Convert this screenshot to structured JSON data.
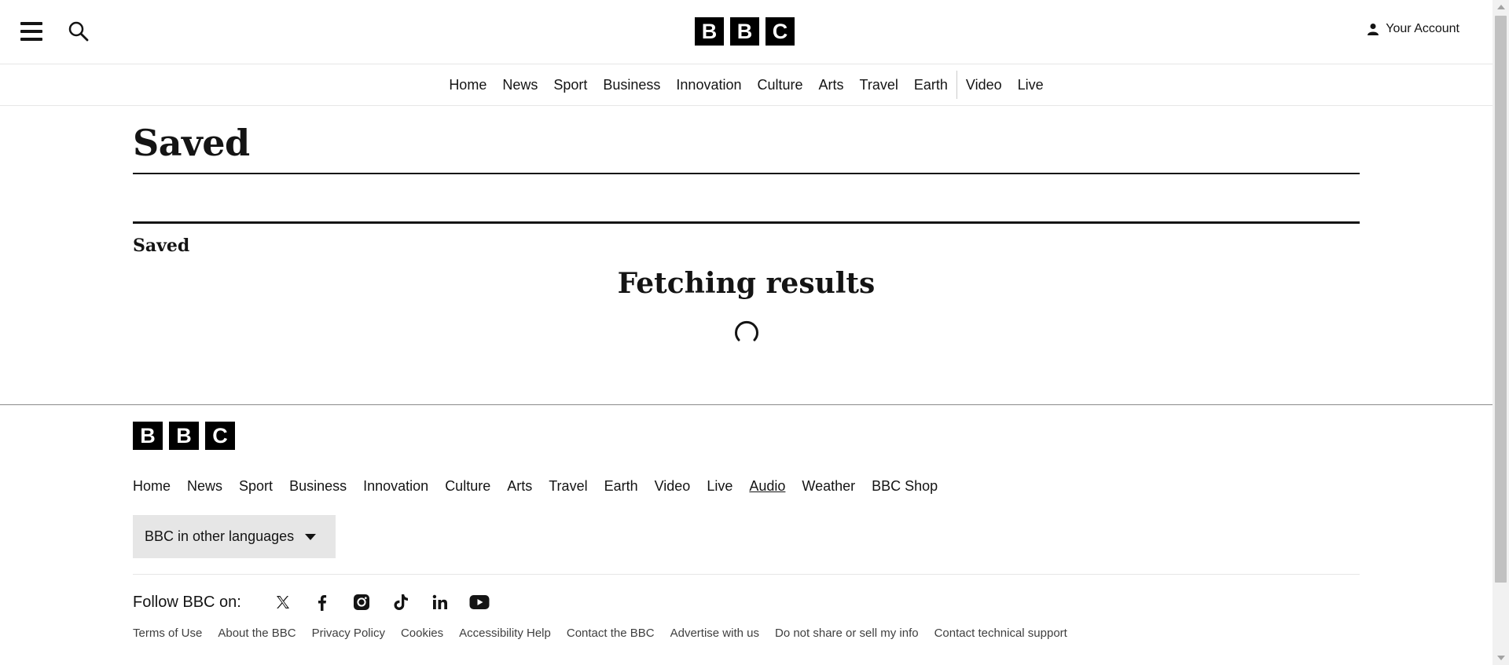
{
  "header": {
    "logo": [
      "B",
      "B",
      "C"
    ],
    "account_label": "Your Account",
    "nav": [
      "Home",
      "News",
      "Sport",
      "Business",
      "Innovation",
      "Culture",
      "Arts",
      "Travel",
      "Earth",
      "Video",
      "Live"
    ]
  },
  "main": {
    "title": "Saved",
    "section_heading": "Saved",
    "loading_text": "Fetching results"
  },
  "footer": {
    "logo": [
      "B",
      "B",
      "C"
    ],
    "nav": [
      "Home",
      "News",
      "Sport",
      "Business",
      "Innovation",
      "Culture",
      "Arts",
      "Travel",
      "Earth",
      "Video",
      "Live",
      "Audio",
      "Weather",
      "BBC Shop"
    ],
    "languages_button": "BBC in other languages",
    "follow_label": "Follow BBC on:",
    "social_icons": [
      "x-icon",
      "facebook-icon",
      "instagram-icon",
      "tiktok-icon",
      "linkedin-icon",
      "youtube-icon"
    ],
    "legal_links": [
      "Terms of Use",
      "About the BBC",
      "Privacy Policy",
      "Cookies",
      "Accessibility Help",
      "Contact the BBC",
      "Advertise with us",
      "Do not share or sell my info",
      "Contact technical support"
    ]
  }
}
